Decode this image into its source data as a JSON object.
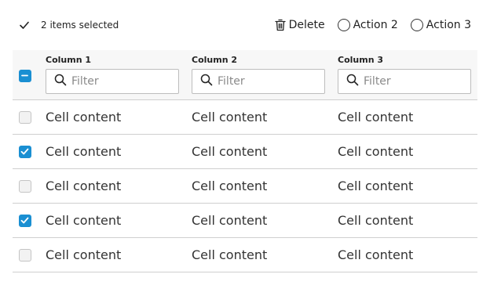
{
  "toolbar": {
    "selection_text": "2 items selected",
    "actions": [
      {
        "label": "Delete",
        "icon": "trash-icon"
      },
      {
        "label": "Action 2",
        "icon": "radio-icon"
      },
      {
        "label": "Action 3",
        "icon": "radio-icon"
      }
    ]
  },
  "table": {
    "header_checkbox_state": "indeterminate",
    "columns": [
      {
        "label": "Column 1",
        "filter_placeholder": "Filter"
      },
      {
        "label": "Column 2",
        "filter_placeholder": "Filter"
      },
      {
        "label": "Column 3",
        "filter_placeholder": "Filter"
      }
    ],
    "rows": [
      {
        "checked": false,
        "cells": [
          "Cell content",
          "Cell content",
          "Cell content"
        ]
      },
      {
        "checked": true,
        "cells": [
          "Cell content",
          "Cell content",
          "Cell content"
        ]
      },
      {
        "checked": false,
        "cells": [
          "Cell content",
          "Cell content",
          "Cell content"
        ]
      },
      {
        "checked": true,
        "cells": [
          "Cell content",
          "Cell content",
          "Cell content"
        ]
      },
      {
        "checked": false,
        "cells": [
          "Cell content",
          "Cell content",
          "Cell content"
        ]
      }
    ]
  },
  "colors": {
    "accent": "#1a8fd2",
    "header_bg": "#f7f7f7",
    "border": "#cfcfcf"
  }
}
